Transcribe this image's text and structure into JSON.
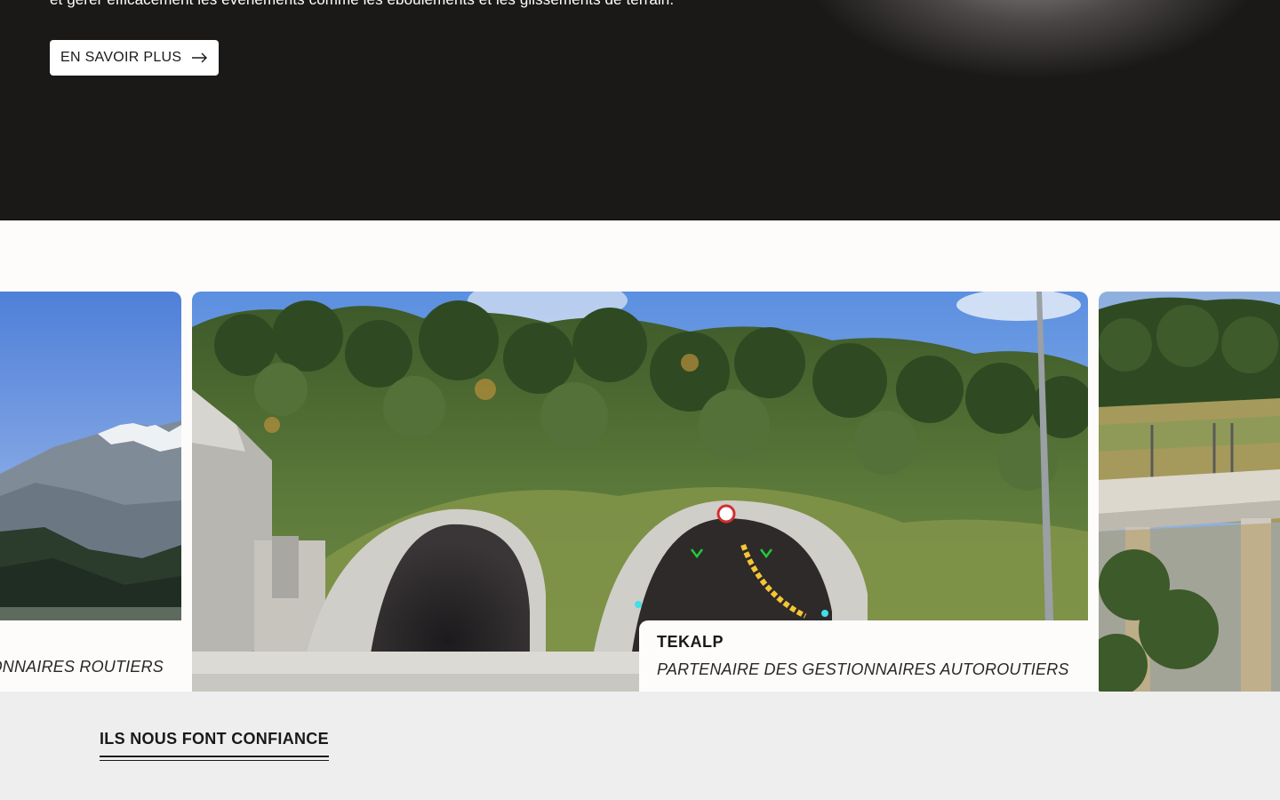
{
  "hero": {
    "text": "et gérer efficacement les événements comme les éboulements et les glissements de terrain.",
    "button_label": "EN SAVOIR PLUS"
  },
  "carousel": {
    "left_card": {
      "subtitle": "ONNAIRES ROUTIERS"
    },
    "main_card": {
      "title": "TEKALP",
      "subtitle": "PARTENAIRE DES GESTIONNAIRES AUTOROUTIERS"
    }
  },
  "trust": {
    "title": "ILS NOUS FONT CONFIANCE"
  },
  "icons": {
    "button_arrow": "arrow-right-icon",
    "tunnel_sign": "speed-limit-sign"
  },
  "colors": {
    "dark": "#1b1918",
    "light": "#fdfcfb",
    "section_gray": "#eeeeee"
  }
}
